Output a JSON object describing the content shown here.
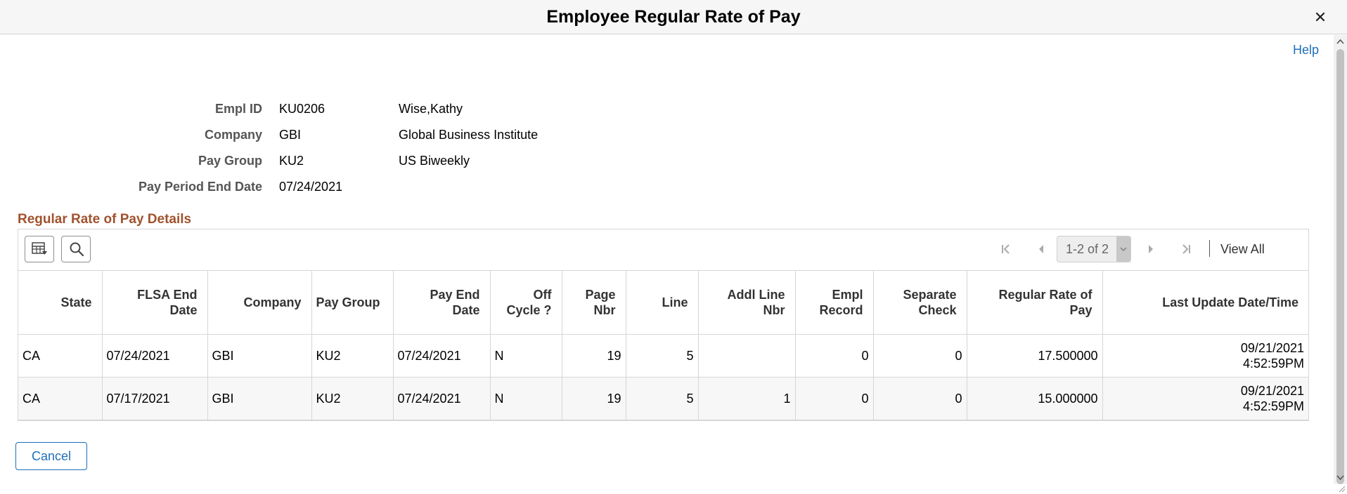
{
  "modal": {
    "title": "Employee Regular Rate of Pay",
    "help_label": "Help",
    "cancel_label": "Cancel"
  },
  "employee": [
    {
      "label": "Empl ID",
      "value": "KU0206",
      "desc": "Wise,Kathy"
    },
    {
      "label": "Company",
      "value": "GBI",
      "desc": "Global Business Institute"
    },
    {
      "label": "Pay Group",
      "value": "KU2",
      "desc": "US Biweekly"
    },
    {
      "label": "Pay Period End Date",
      "value": "07/24/2021",
      "desc": ""
    }
  ],
  "section": {
    "title": "Regular Rate of Pay Details"
  },
  "grid": {
    "pager_text": "1-2 of 2",
    "view_all_label": "View All",
    "columns": [
      {
        "line1": "State",
        "line2": ""
      },
      {
        "line1": "FLSA End",
        "line2": "Date"
      },
      {
        "line1": "Company",
        "line2": ""
      },
      {
        "line1": "Pay Group",
        "line2": ""
      },
      {
        "line1": "Pay End",
        "line2": "Date"
      },
      {
        "line1": "Off",
        "line2": "Cycle ?"
      },
      {
        "line1": "Page",
        "line2": "Nbr"
      },
      {
        "line1": "Line",
        "line2": ""
      },
      {
        "line1": "Addl Line",
        "line2": "Nbr"
      },
      {
        "line1": "Empl",
        "line2": "Record"
      },
      {
        "line1": "Separate",
        "line2": "Check"
      },
      {
        "line1": "Regular Rate of",
        "line2": "Pay"
      },
      {
        "line1": "Last Update Date/Time",
        "line2": ""
      }
    ],
    "rows": [
      {
        "state": "CA",
        "flsa_end_date": "07/24/2021",
        "company": "GBI",
        "pay_group": "KU2",
        "pay_end_date": "07/24/2021",
        "off_cycle": "N",
        "page_nbr": "19",
        "line": "5",
        "addl_line_nbr": "",
        "empl_record": "0",
        "separate_check": "0",
        "regular_rate": "17.500000",
        "last_update_date": "09/21/2021",
        "last_update_time": "4:52:59PM"
      },
      {
        "state": "CA",
        "flsa_end_date": "07/17/2021",
        "company": "GBI",
        "pay_group": "KU2",
        "pay_end_date": "07/24/2021",
        "off_cycle": "N",
        "page_nbr": "19",
        "line": "5",
        "addl_line_nbr": "1",
        "empl_record": "0",
        "separate_check": "0",
        "regular_rate": "15.000000",
        "last_update_date": "09/21/2021",
        "last_update_time": "4:52:59PM"
      }
    ]
  }
}
